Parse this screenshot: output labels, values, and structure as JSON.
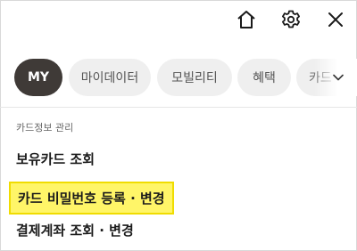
{
  "toolbar": {
    "home_icon": "home-icon",
    "settings_icon": "gear-icon",
    "close_icon": "close-icon"
  },
  "tabs": [
    {
      "label": "MY",
      "active": true
    },
    {
      "label": "마이데이터",
      "active": false
    },
    {
      "label": "모빌리티",
      "active": false
    },
    {
      "label": "혜택",
      "active": false
    },
    {
      "label": "카드",
      "active": false
    }
  ],
  "section": {
    "title": "카드정보 관리",
    "items": [
      {
        "label": "보유카드 조회"
      },
      {
        "label": "카드 비밀번호 등록 · 변경",
        "highlighted": true
      },
      {
        "label": "결제계좌 조회 · 변경"
      }
    ]
  },
  "colors": {
    "active_chip": "#3f3a37",
    "chip": "#efefef",
    "highlight": "#fff568",
    "highlight_border": "#f0dc00"
  }
}
